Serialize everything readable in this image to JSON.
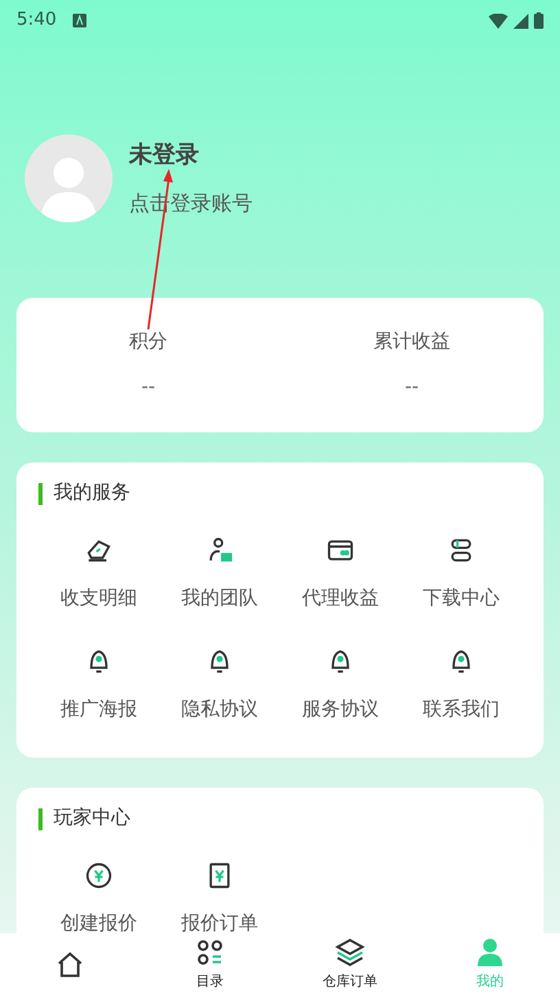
{
  "status_bar": {
    "time": "5:40"
  },
  "profile": {
    "name": "未登录",
    "hint": "点击登录账号"
  },
  "stats": [
    {
      "label": "积分",
      "value": "--"
    },
    {
      "label": "累计收益",
      "value": "--"
    }
  ],
  "services": {
    "title": "我的服务",
    "items": [
      {
        "label": "收支明细",
        "kind": "ticket"
      },
      {
        "label": "我的团队",
        "kind": "team"
      },
      {
        "label": "代理收益",
        "kind": "card"
      },
      {
        "label": "下载中心",
        "kind": "stack"
      },
      {
        "label": "推广海报",
        "kind": "bell"
      },
      {
        "label": "隐私协议",
        "kind": "bell"
      },
      {
        "label": "服务协议",
        "kind": "bell"
      },
      {
        "label": "联系我们",
        "kind": "bell"
      }
    ]
  },
  "player_center": {
    "title": "玩家中心",
    "items": [
      {
        "label": "创建报价",
        "kind": "coin"
      },
      {
        "label": "报价订单",
        "kind": "receipt"
      }
    ]
  },
  "tab_bar": [
    {
      "kind": "home",
      "selected": false
    },
    {
      "label": "目录",
      "kind": "grid",
      "selected": false
    },
    {
      "label": "仓库订单",
      "kind": "layers",
      "selected": false
    },
    {
      "label": "我的",
      "kind": "person",
      "selected": true
    }
  ]
}
